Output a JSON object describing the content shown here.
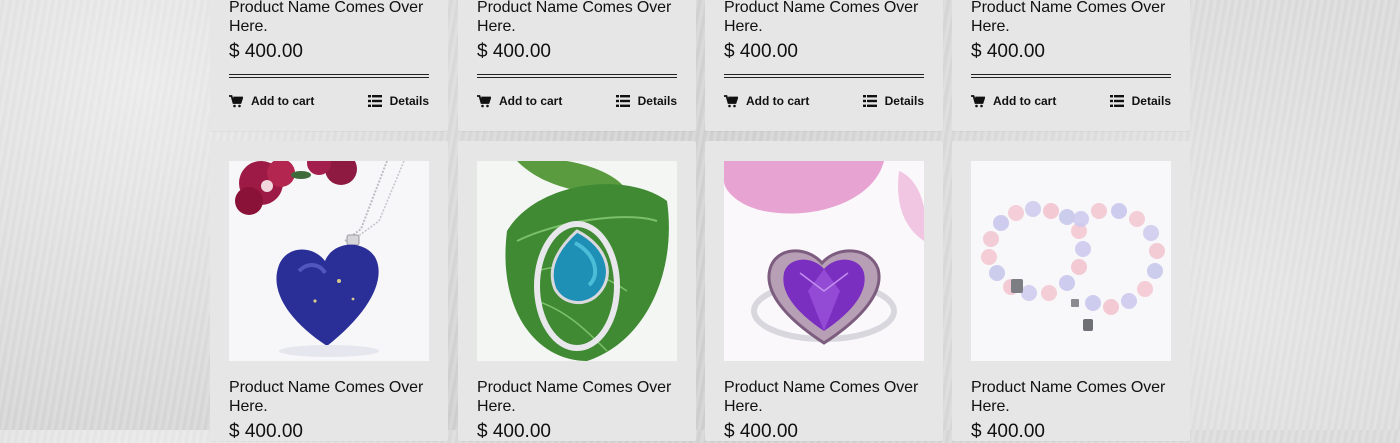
{
  "products": [
    {
      "name": "Product Name Comes Over Here.",
      "price": "$ 400.00",
      "add_to_cart": "Add to cart",
      "details": "Details"
    },
    {
      "name": "Product Name Comes Over Here.",
      "price": "$ 400.00",
      "add_to_cart": "Add to cart",
      "details": "Details"
    },
    {
      "name": "Product Name Comes Over Here.",
      "price": "$ 400.00",
      "add_to_cart": "Add to cart",
      "details": "Details"
    },
    {
      "name": "Product Name Comes Over Here.",
      "price": "$ 400.00",
      "add_to_cart": "Add to cart",
      "details": "Details"
    },
    {
      "name": "Product Name Comes Over Here.",
      "price": "$ 400.00",
      "image": "lapis-heart-necklace"
    },
    {
      "name": "Product Name Comes Over Here.",
      "price": "$ 400.00",
      "image": "turquoise-teardrop-ring"
    },
    {
      "name": "Product Name Comes Over Here.",
      "price": "$ 400.00",
      "image": "amethyst-heart-ring"
    },
    {
      "name": "Product Name Comes Over Here.",
      "price": "$ 400.00",
      "image": "rose-quartz-bracelets"
    }
  ],
  "icons": {
    "cart": "shopping-cart-icon",
    "details": "list-icon"
  },
  "colors": {
    "card_bg": "#e6e6e6",
    "text": "#111111"
  }
}
